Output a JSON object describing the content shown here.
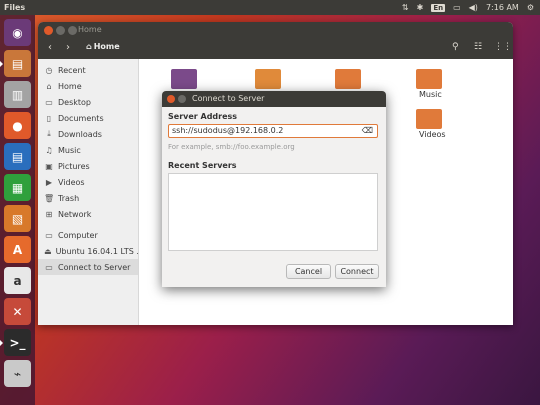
{
  "top_panel": {
    "app_title": "Files",
    "indicators": [
      "sort-icon",
      "bluetooth-icon",
      "keyboard-language",
      "battery-icon",
      "volume-icon"
    ],
    "keyboard_lang": "En",
    "clock": "7:16 AM"
  },
  "launcher": {
    "items": [
      {
        "name": "ubuntu-logo-icon",
        "color": "#6b3a78"
      },
      {
        "name": "files-icon",
        "color": "#c9773a"
      },
      {
        "name": "file-cabinet-icon",
        "color": "#a3a3a3"
      },
      {
        "name": "firefox-icon",
        "color": "#e0592a"
      },
      {
        "name": "writer-icon",
        "color": "#2a6ebd"
      },
      {
        "name": "calc-icon",
        "color": "#2fa03c"
      },
      {
        "name": "impress-icon",
        "color": "#d8792a"
      },
      {
        "name": "software-center-icon",
        "color": "#e66a2c"
      },
      {
        "name": "amazon-icon",
        "color": "#e8e8e8"
      },
      {
        "name": "settings-icon",
        "color": "#c64a3a"
      },
      {
        "name": "terminal-icon",
        "color": "#2b2b2b"
      },
      {
        "name": "usb-drive-icon",
        "color": "#c9c9c9"
      }
    ]
  },
  "files": {
    "title": "Home",
    "path": "Home",
    "sidebar": [
      {
        "icon": "clock-icon",
        "glyph": "◷",
        "label": "Recent"
      },
      {
        "icon": "home-icon",
        "glyph": "⌂",
        "label": "Home"
      },
      {
        "icon": "desktop-icon",
        "glyph": "▭",
        "label": "Desktop"
      },
      {
        "icon": "documents-icon",
        "glyph": "▯",
        "label": "Documents"
      },
      {
        "icon": "downloads-icon",
        "glyph": "⤓",
        "label": "Downloads"
      },
      {
        "icon": "music-icon",
        "glyph": "♫",
        "label": "Music"
      },
      {
        "icon": "pictures-icon",
        "glyph": "▣",
        "label": "Pictures"
      },
      {
        "icon": "videos-icon",
        "glyph": "▶",
        "label": "Videos"
      },
      {
        "icon": "trash-icon",
        "glyph": "🗑",
        "label": "Trash"
      },
      {
        "icon": "network-icon",
        "glyph": "⊞",
        "label": "Network"
      },
      {
        "icon": "computer-icon",
        "glyph": "▭",
        "label": "Computer"
      },
      {
        "icon": "drive-icon",
        "glyph": "⏏",
        "label": "Ubuntu 16.04.1 LTS ..."
      },
      {
        "icon": "connect-server-icon",
        "glyph": "▭",
        "label": "Connect to Server"
      }
    ],
    "folders": [
      {
        "name": "desktop-folder",
        "label": "",
        "color": "#7b4a8a"
      },
      {
        "name": "documents-folder",
        "label": "",
        "color": "#e08a3a"
      },
      {
        "name": "downloads-folder",
        "label": "",
        "color": "#e07a3a"
      },
      {
        "name": "music-folder",
        "label": "Music",
        "color": "#e07a3a"
      },
      {
        "name": "videos-folder",
        "label": "Videos",
        "color": "#e07a3a"
      }
    ]
  },
  "dialog": {
    "title": "Connect to Server",
    "server_address_label": "Server Address",
    "server_address_value": "ssh://sudodus@192.168.0.2",
    "server_address_hint": "For example, smb://foo.example.org",
    "recent_servers_label": "Recent Servers",
    "cancel_label": "Cancel",
    "connect_label": "Connect"
  }
}
